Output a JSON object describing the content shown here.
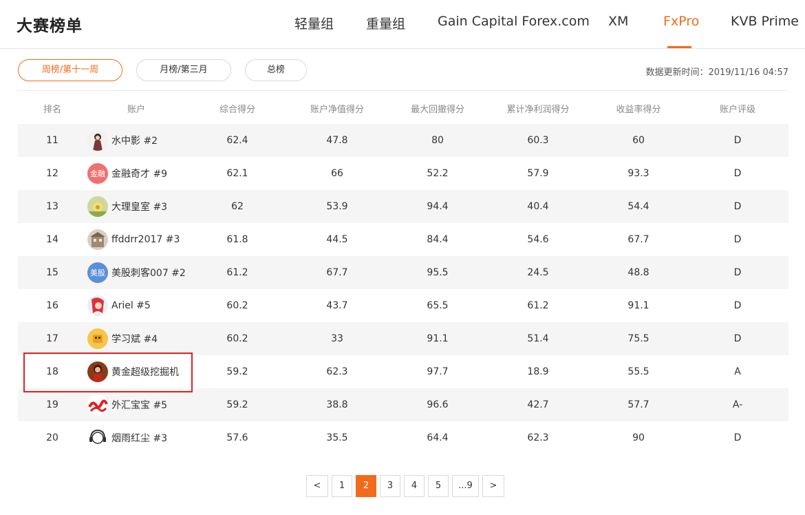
{
  "site": {
    "title": "大赛榜单"
  },
  "nav": {
    "tabs": [
      {
        "label": "轻量组",
        "active": false
      },
      {
        "label": "重量组",
        "active": false
      },
      {
        "label": "Gain Capital Forex.com",
        "active": false
      },
      {
        "label": "XM",
        "active": false
      },
      {
        "label": "FxPro",
        "active": true
      },
      {
        "label": "KVB Prime",
        "active": false
      }
    ]
  },
  "filters": {
    "buttons": [
      {
        "label": "周榜/第十一周",
        "active": true
      },
      {
        "label": "月榜/第三月",
        "active": false
      },
      {
        "label": "总榜",
        "active": false
      }
    ],
    "update_label": "数据更新时间：",
    "update_time": "2019/11/16 04:57"
  },
  "table": {
    "headers": [
      "排名",
      "账户",
      "综合得分",
      "账户净值得分",
      "最大回撤得分",
      "累计净利润得分",
      "收益率得分",
      "账户评级"
    ],
    "rows": [
      {
        "rank": "11",
        "name": "水中影 #2",
        "avatar": "girl-avatar",
        "score": "62.4",
        "equity": "47.8",
        "drawdown": "80",
        "profit": "60.3",
        "yield": "60",
        "rating": "D"
      },
      {
        "rank": "12",
        "name": "金融奇才 #9",
        "avatar": "text-avatar",
        "avatar_text": "金融",
        "score": "62.1",
        "equity": "66",
        "drawdown": "52.2",
        "profit": "57.9",
        "yield": "93.3",
        "rating": "D"
      },
      {
        "rank": "13",
        "name": "大理皇室 #3",
        "avatar": "flower-avatar",
        "score": "62",
        "equity": "53.9",
        "drawdown": "94.4",
        "profit": "40.4",
        "yield": "54.4",
        "rating": "D"
      },
      {
        "rank": "14",
        "name": "ffddrr2017 #3",
        "avatar": "building-avatar",
        "score": "61.8",
        "equity": "44.5",
        "drawdown": "84.4",
        "profit": "54.6",
        "yield": "67.7",
        "rating": "D"
      },
      {
        "rank": "15",
        "name": "美股刺客007 #2",
        "avatar": "text-avatar",
        "avatar_text": "美股",
        "score": "61.2",
        "equity": "67.7",
        "drawdown": "95.5",
        "profit": "24.5",
        "yield": "48.8",
        "rating": "D"
      },
      {
        "rank": "16",
        "name": "Ariel #5",
        "avatar": "mermaid-avatar",
        "score": "60.2",
        "equity": "43.7",
        "drawdown": "65.5",
        "profit": "61.2",
        "yield": "91.1",
        "rating": "D"
      },
      {
        "rank": "17",
        "name": "学习斌 #4",
        "avatar": "cartoon-avatar",
        "score": "60.2",
        "equity": "33",
        "drawdown": "91.1",
        "profit": "51.4",
        "yield": "75.5",
        "rating": "D"
      },
      {
        "rank": "18",
        "name": "黄金超级挖掘机",
        "avatar": "woman-avatar",
        "score": "59.2",
        "equity": "62.3",
        "drawdown": "97.7",
        "profit": "18.9",
        "yield": "55.5",
        "rating": "A"
      },
      {
        "rank": "19",
        "name": "外汇宝宝 #5",
        "avatar": "logo-avatar",
        "score": "59.2",
        "equity": "38.8",
        "drawdown": "96.6",
        "profit": "42.7",
        "yield": "57.7",
        "rating": "A-"
      },
      {
        "rank": "20",
        "name": "烟雨红尘 #3",
        "avatar": "headphone-avatar",
        "score": "57.6",
        "equity": "35.5",
        "drawdown": "64.4",
        "profit": "62.3",
        "yield": "90",
        "rating": "D"
      }
    ]
  },
  "pagination": {
    "prev": "<",
    "pages": [
      "1",
      "2",
      "3",
      "4",
      "5",
      "...9"
    ],
    "current": "2",
    "next": ">"
  },
  "colors": {
    "accent": "#f26b1d",
    "highlight": "#e02020",
    "row_shade": "#f5f5f5",
    "avatar_jinrong": "#f07070",
    "avatar_meigu": "#5b8fd8"
  }
}
